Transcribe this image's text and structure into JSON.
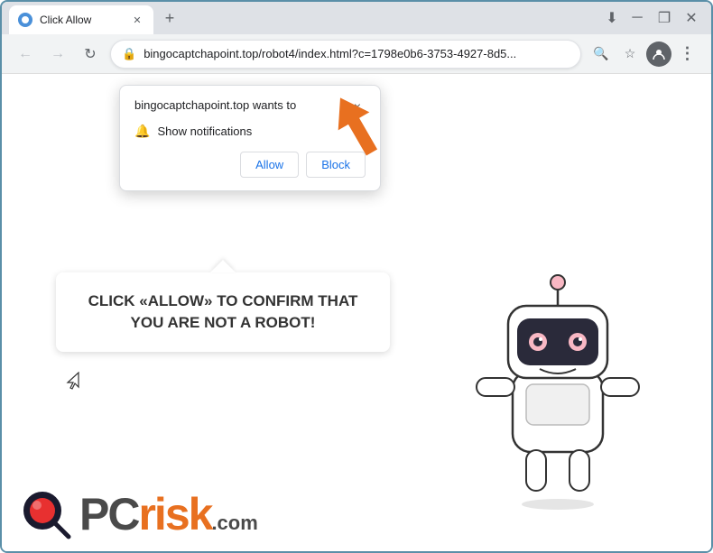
{
  "browser": {
    "tab": {
      "title": "Click Allow",
      "favicon_label": "favicon"
    },
    "new_tab_button": "+",
    "window_controls": {
      "minimize": "─",
      "maximize": "□",
      "close": "✕"
    },
    "address_bar": {
      "url": "bingocaptchapoint.top/robot4/index.html?c=1798e0b6-3753-4927-8d5...",
      "lock_icon": "🔒",
      "back_disabled": true,
      "forward_disabled": true
    }
  },
  "notification_popup": {
    "site_text": "bingocaptchapoint.top wants to",
    "permission_label": "Show notifications",
    "close_button_label": "×",
    "allow_button": "Allow",
    "block_button": "Block"
  },
  "page": {
    "message": "CLICK «ALLOW» TO CONFIRM THAT YOU ARE NOT A ROBOT!"
  },
  "logo": {
    "pc_text": "PC",
    "risk_text": "risk",
    "com_text": ".com"
  },
  "cursor_icon": "↖",
  "colors": {
    "accent_blue": "#1a73e8",
    "arrow_orange": "#e87020",
    "browser_border": "#5a8fa8"
  }
}
